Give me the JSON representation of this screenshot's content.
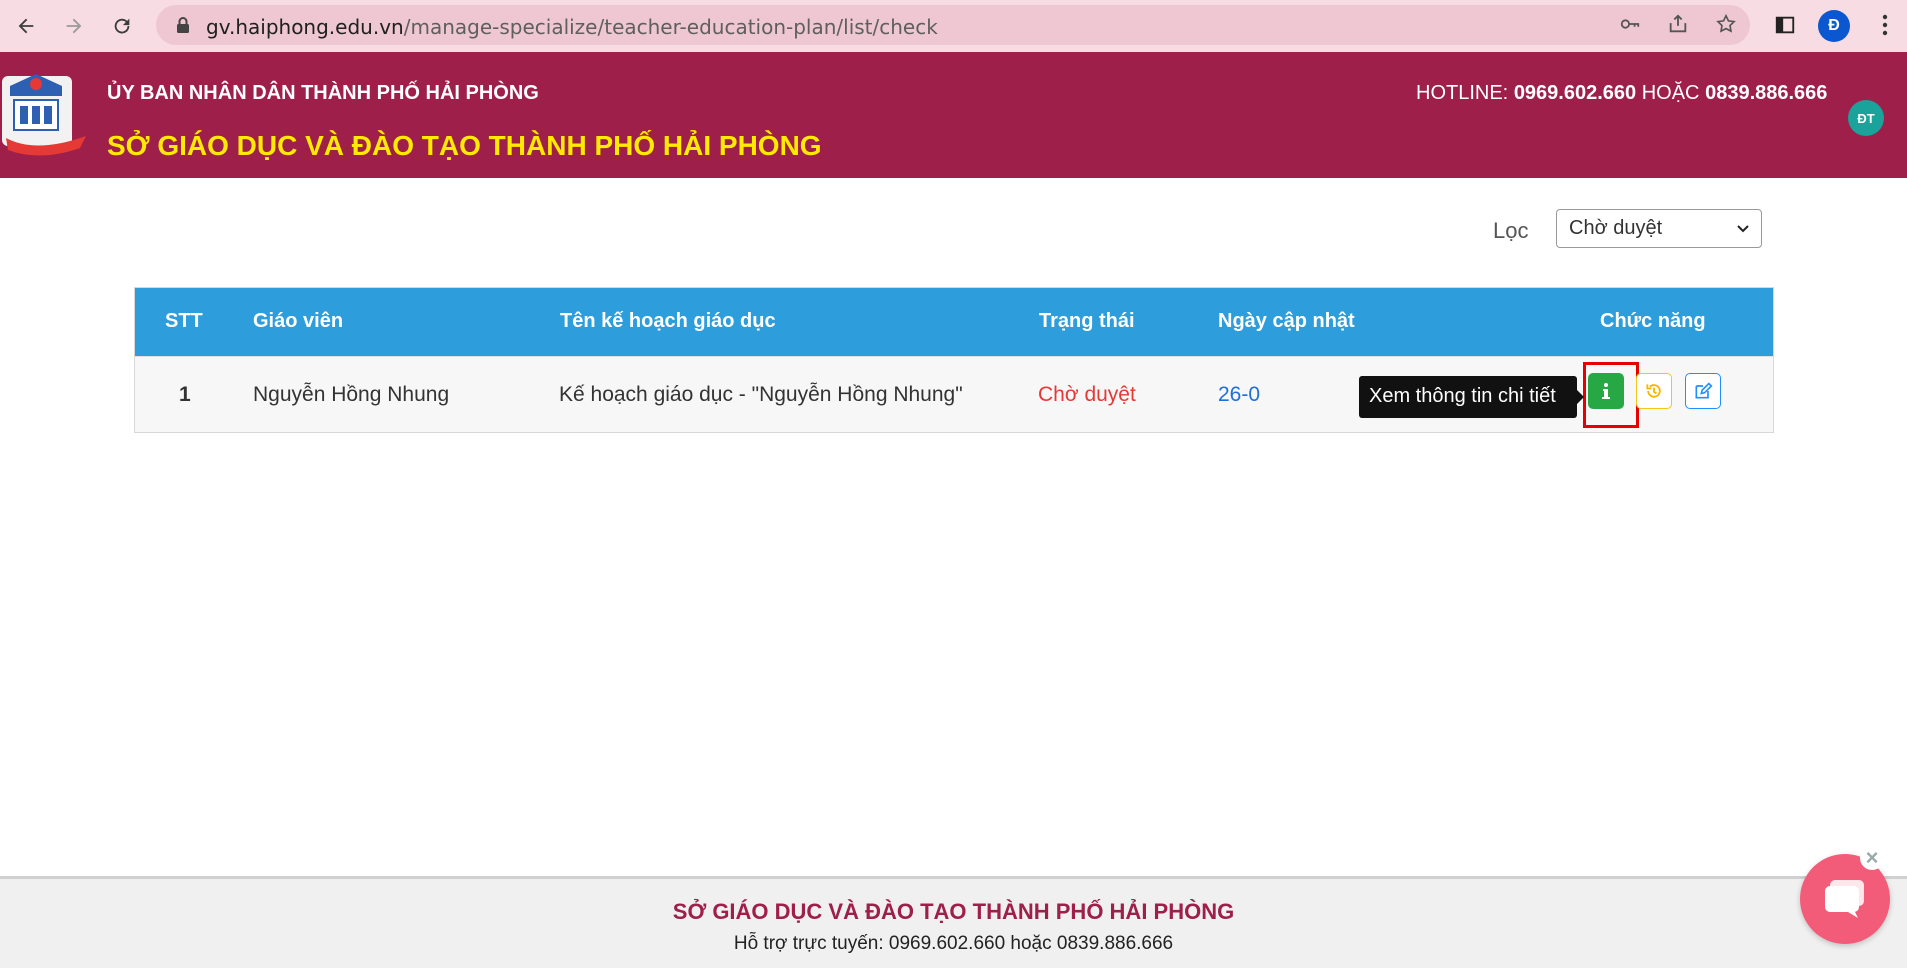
{
  "browser": {
    "url_host": "gv.haiphong.edu.vn",
    "url_path": "/manage-specialize/teacher-education-plan/list/check",
    "profile_initial": "Đ"
  },
  "header": {
    "line1": "ỦY BAN NHÂN DÂN THÀNH PHỐ HẢI PHÒNG",
    "line2": "SỞ GIÁO DỤC VÀ ĐÀO TẠO THÀNH PHỐ HẢI PHÒNG",
    "hotline_label": "HOTLINE:",
    "hotline_1": "0969.602.660",
    "hotline_or": "HOẶC",
    "hotline_2": "0839.886.666",
    "user_initials": "ĐT"
  },
  "filter": {
    "label": "Lọc",
    "selected": "Chờ duyệt"
  },
  "table": {
    "headers": {
      "stt": "STT",
      "teacher": "Giáo viên",
      "plan": "Tên kế hoạch giáo dục",
      "status": "Trạng thái",
      "updated": "Ngày cập nhật",
      "actions": "Chức năng"
    },
    "rows": [
      {
        "stt": "1",
        "teacher": "Nguyễn Hồng Nhung",
        "plan": "Kế hoạch giáo dục - \"Nguyễn Hồng Nhung\"",
        "status": "Chờ duyệt",
        "updated": "26-0"
      }
    ],
    "status_color": "#e53935",
    "date_color": "#1e6fd9"
  },
  "tooltip": {
    "text": "Xem thông tin chi tiết"
  },
  "footer": {
    "title": "SỞ GIÁO DỤC VÀ ĐÀO TẠO THÀNH PHỐ HẢI PHÒNG",
    "support": "Hỗ trợ trực tuyến: 0969.602.660 hoặc 0839.886.666"
  },
  "colors": {
    "brand": "#9e1f4a",
    "header_yellow": "#ffea00",
    "table_header": "#2e9ddb",
    "info_button": "#28a745"
  }
}
